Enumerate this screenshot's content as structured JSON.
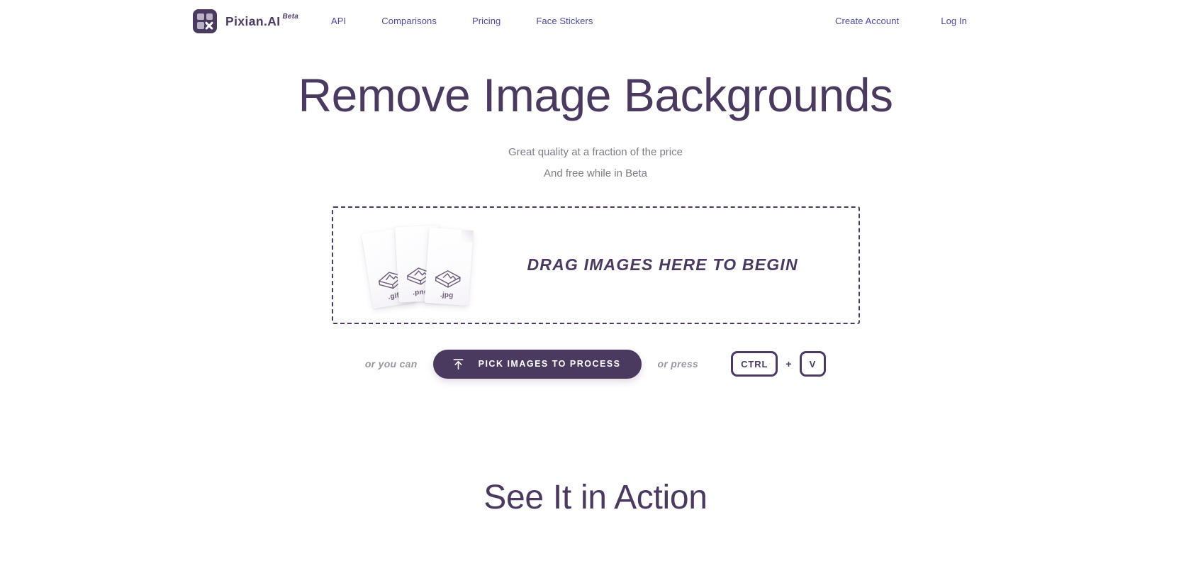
{
  "header": {
    "brand": {
      "name": "Pixian.AI",
      "beta": "Beta",
      "logo_icon": "pixian-logo-icon"
    },
    "nav": [
      {
        "label": "API"
      },
      {
        "label": "Comparisons"
      },
      {
        "label": "Pricing"
      },
      {
        "label": "Face Stickers"
      }
    ],
    "account": [
      {
        "label": "Create Account"
      },
      {
        "label": "Log In"
      }
    ]
  },
  "hero": {
    "title": "Remove Image Backgrounds",
    "subtitle_1": "Great quality at a fraction of the price",
    "subtitle_2": "And free while in Beta"
  },
  "dropzone": {
    "cta": "DRAG IMAGES HERE TO BEGIN",
    "files": [
      {
        "ext": ".gif",
        "icon": "image-file-icon"
      },
      {
        "ext": ".png",
        "icon": "image-file-icon"
      },
      {
        "ext": ".jpg",
        "icon": "image-file-icon"
      }
    ]
  },
  "actions": {
    "or_you_can": "or you can",
    "pick_button": "PICK IMAGES TO PROCESS",
    "pick_button_icon": "upload-arrow-icon",
    "or_press": "or press",
    "key_ctrl": "CTRL",
    "key_plus": "+",
    "key_v": "V"
  },
  "section": {
    "title": "See It in Action"
  },
  "colors": {
    "brand_purple": "#4b3a5f",
    "nav_link": "#4b4b9e",
    "muted_text": "#7d7b86",
    "gray_bold": "#9a98a4"
  }
}
